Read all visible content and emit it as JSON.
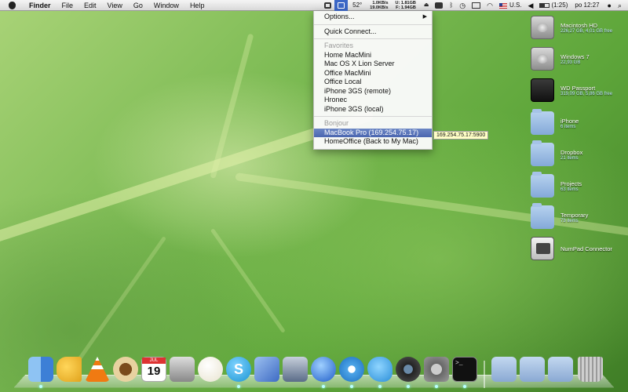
{
  "menubar": {
    "app_name": "Finder",
    "menus": [
      "File",
      "Edit",
      "View",
      "Go",
      "Window",
      "Help"
    ],
    "status": {
      "temperature": "52°",
      "net_up": "1.0KB/s",
      "net_down": "19.0KB/s",
      "mem_used": "1.81GB",
      "mem_free": "1.94GB",
      "mem_u_label": "U:",
      "mem_f_label": "F:",
      "battery": "(1:25)",
      "input_source": "U.S.",
      "clock": "po 12:27"
    }
  },
  "dropdown": {
    "options_label": "Options...",
    "quick_connect_label": "Quick Connect...",
    "favorites_header": "Favorites",
    "favorites": [
      "Home MacMini",
      "Mac OS X Lion Server",
      "Office MacMini",
      "Office Local",
      "iPhone 3GS (remote)",
      "Hronec",
      "iPhone 3GS (local)"
    ],
    "bonjour_header": "Bonjour",
    "bonjour": [
      "MacBook Pro (169.254.75.17)",
      "HomeOffice (Back to My Mac)"
    ],
    "tooltip": "169.254.75.17:5900"
  },
  "desktop_icons": [
    {
      "name": "Macintosh HD",
      "info": "226,27 GB, 4,01 GB free",
      "icon": "hard-drive-icon"
    },
    {
      "name": "Windows 7",
      "info": "22,93 GB",
      "icon": "hard-drive-icon"
    },
    {
      "name": "WD Passport",
      "info": "319,09 GB, 5,86 GB free",
      "icon": "external-drive-icon"
    },
    {
      "name": "iPhone",
      "info": "6 items",
      "icon": "folder-icon"
    },
    {
      "name": "Dropbox",
      "info": "21 items",
      "icon": "folder-icon"
    },
    {
      "name": "Projects",
      "info": "63 items",
      "icon": "folder-icon"
    },
    {
      "name": "Temporary",
      "info": "73 items",
      "icon": "folder-icon"
    },
    {
      "name": "NumPad Connector",
      "info": "",
      "icon": "app-icon"
    }
  ],
  "dock": {
    "calendar_month": "JUL",
    "calendar_day": "19",
    "items": [
      {
        "name": "finder-icon",
        "color": "#4b8de0"
      },
      {
        "name": "megaphone-icon",
        "color": "#e0a21c"
      },
      {
        "name": "vlc-icon",
        "color": "#f07a12"
      },
      {
        "name": "coffee-cup-icon",
        "color": "#c99a4b"
      },
      {
        "name": "calendar-icon",
        "color": "#ffffff"
      },
      {
        "name": "script-editor-icon",
        "color": "#b8b8b8"
      },
      {
        "name": "speech-bubble-icon",
        "color": "#f6f4e8"
      },
      {
        "name": "skype-icon",
        "color": "#1da1dc"
      },
      {
        "name": "xcode-icon",
        "color": "#4f7fd3"
      },
      {
        "name": "eagle-app-icon",
        "color": "#6d7f99"
      },
      {
        "name": "itunes-icon",
        "color": "#2f6bd1"
      },
      {
        "name": "safari-icon",
        "color": "#3e8fd8"
      },
      {
        "name": "twitter-bird-icon",
        "color": "#3ea4e3"
      },
      {
        "name": "webcam-icon",
        "color": "#2e2e2e"
      },
      {
        "name": "system-preferences-icon",
        "color": "#8c8c8c"
      },
      {
        "name": "terminal-icon",
        "color": "#111111"
      },
      {
        "name": "applications-stack-icon",
        "color": "#9bb9dd"
      },
      {
        "name": "documents-stack-icon",
        "color": "#9bb9dd"
      },
      {
        "name": "downloads-stack-icon",
        "color": "#9bb9dd"
      },
      {
        "name": "trash-icon",
        "color": "#9a9a9a"
      }
    ]
  }
}
